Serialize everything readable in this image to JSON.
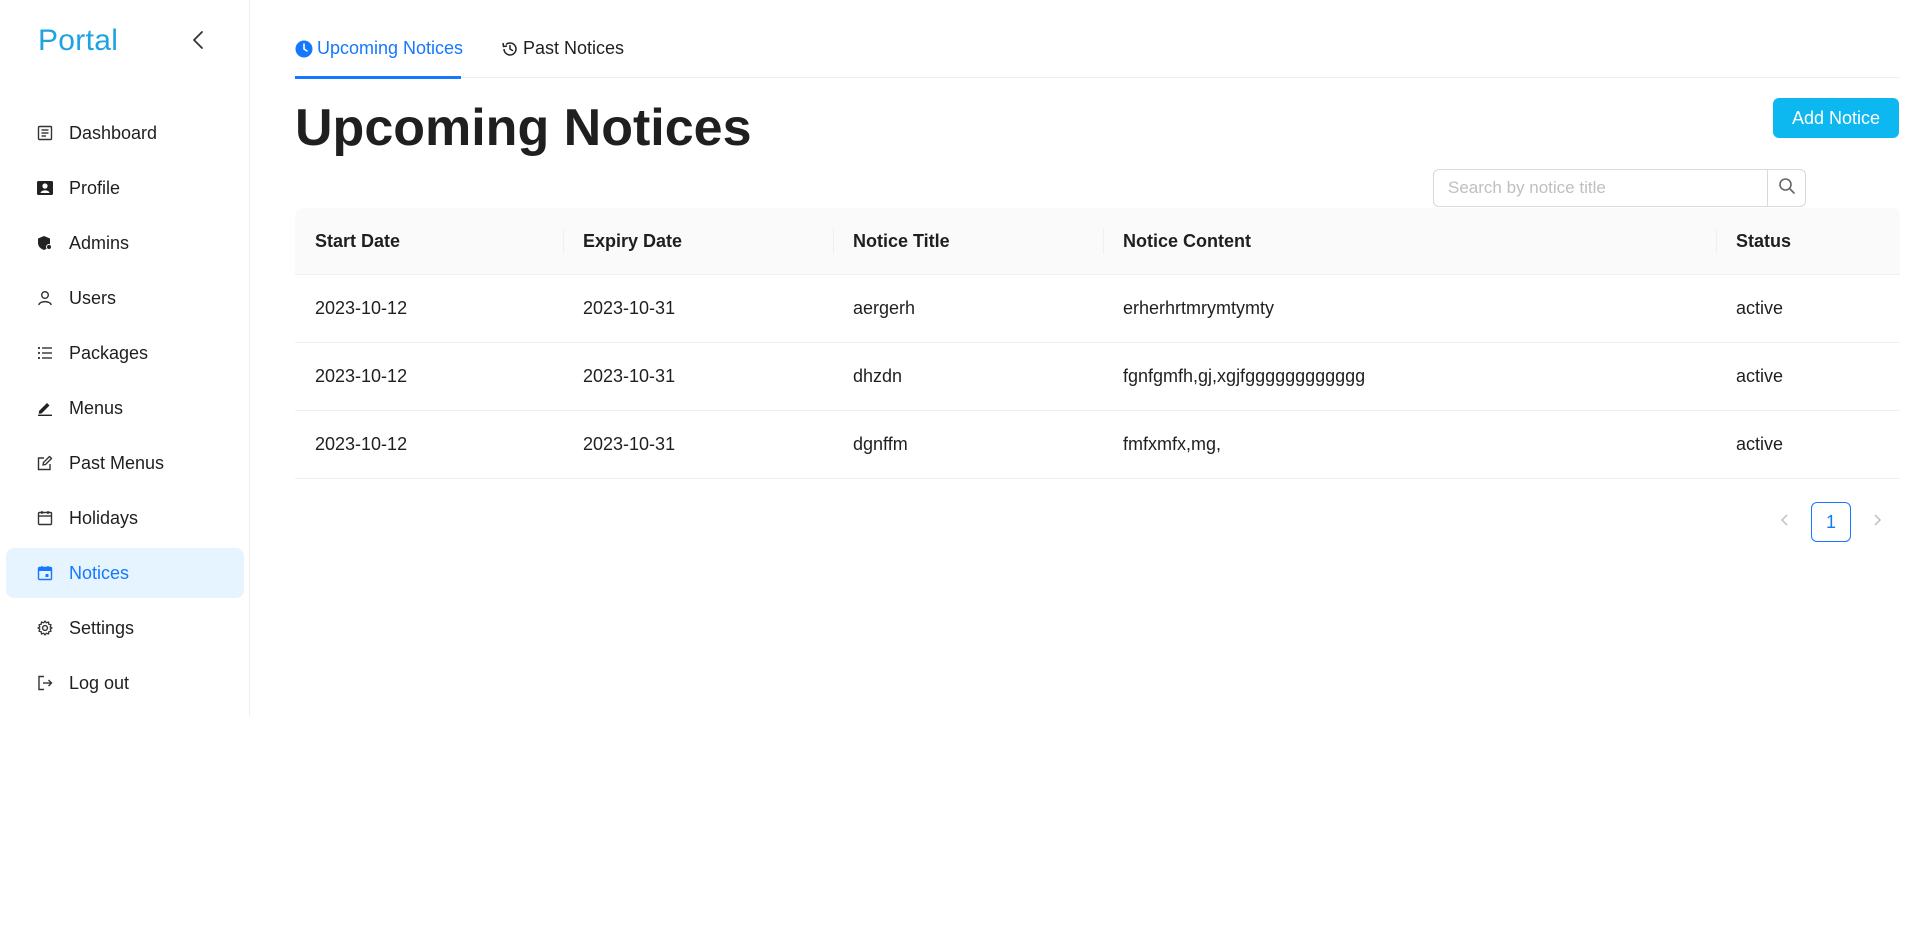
{
  "brand": "Portal",
  "colors": {
    "brand": "#1fa3e0",
    "accent": "#1677ff",
    "button": "#0db7f0",
    "active_bg": "#e6f4ff"
  },
  "sidebar": {
    "collapse_icon": "chevron-left-icon",
    "items": [
      {
        "label": "Dashboard",
        "icon": "dashboard-icon"
      },
      {
        "label": "Profile",
        "icon": "profile-card-icon"
      },
      {
        "label": "Admins",
        "icon": "admin-shield-icon"
      },
      {
        "label": "Users",
        "icon": "user-icon"
      },
      {
        "label": "Packages",
        "icon": "list-icon"
      },
      {
        "label": "Menus",
        "icon": "pen-icon"
      },
      {
        "label": "Past Menus",
        "icon": "edit-icon"
      },
      {
        "label": "Holidays",
        "icon": "calendar-icon"
      },
      {
        "label": "Notices",
        "icon": "calendar-filled-icon",
        "active": true
      },
      {
        "label": "Settings",
        "icon": "gear-icon"
      },
      {
        "label": "Log out",
        "icon": "logout-icon"
      }
    ]
  },
  "tabs": [
    {
      "label": "Upcoming Notices",
      "icon": "clock-icon",
      "active": true
    },
    {
      "label": "Past Notices",
      "icon": "history-icon",
      "active": false
    }
  ],
  "page": {
    "title": "Upcoming Notices",
    "add_button": "Add Notice",
    "search_placeholder": "Search by notice title"
  },
  "table": {
    "columns": [
      "Start Date",
      "Expiry Date",
      "Notice Title",
      "Notice Content",
      "Status"
    ],
    "rows": [
      [
        "2023-10-12",
        "2023-10-31",
        "aergerh",
        "erherhrtmrymtymty",
        "active"
      ],
      [
        "2023-10-12",
        "2023-10-31",
        "dhzdn",
        "fgnfgmfh,gj,xgjfgggggggggggg",
        "active"
      ],
      [
        "2023-10-12",
        "2023-10-31",
        "dgnffm",
        "fmfxmfx,mg,",
        "active"
      ]
    ]
  },
  "pagination": {
    "current": "1"
  }
}
